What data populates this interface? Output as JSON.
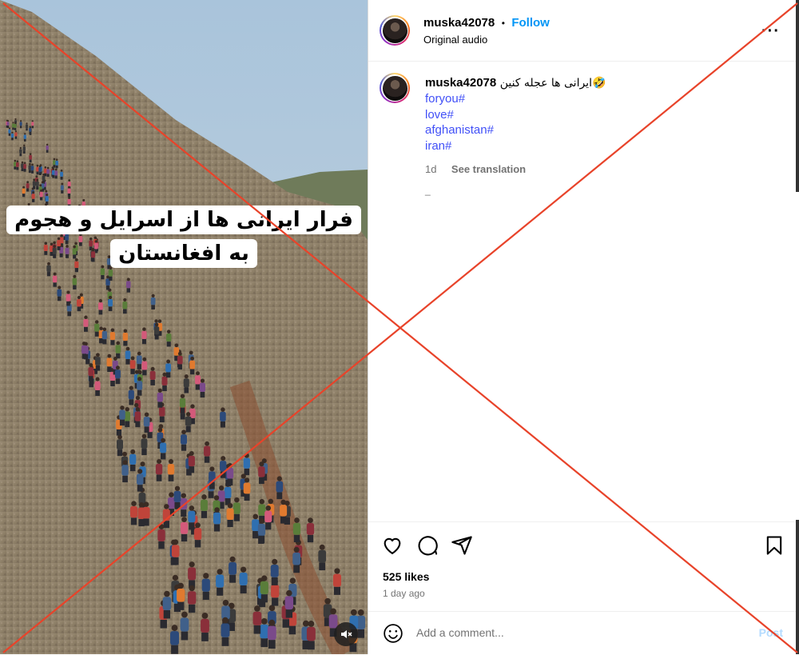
{
  "media": {
    "overlay_line1": "فرار ایرانی ها از اسرایل و هجوم",
    "overlay_line2": "به افغانستان",
    "mute_icon": "speaker-muted-icon"
  },
  "header": {
    "username": "muska42078",
    "separator": "•",
    "follow_label": "Follow",
    "audio_label": "Original audio",
    "more_icon": "more-options-icon"
  },
  "caption": {
    "username": "muska42078",
    "text": "ایرانی ها عجله کنین🤣",
    "hashtags": [
      "foryou#",
      "love#",
      "afghanistan#",
      "iran#"
    ],
    "time": "1d",
    "see_translation": "See translation",
    "underscore": "_"
  },
  "actions": {
    "likes": "525 likes",
    "posted": "1 day ago",
    "icons": [
      "heart-icon",
      "comment-icon",
      "share-icon",
      "bookmark-icon"
    ]
  },
  "comment": {
    "placeholder": "Add a comment...",
    "post_label": "Post",
    "emoji_icon": "emoji-icon"
  },
  "colors": {
    "follow": "#0095f6",
    "hashtag": "#4150f7",
    "cross": "#e8432a"
  }
}
